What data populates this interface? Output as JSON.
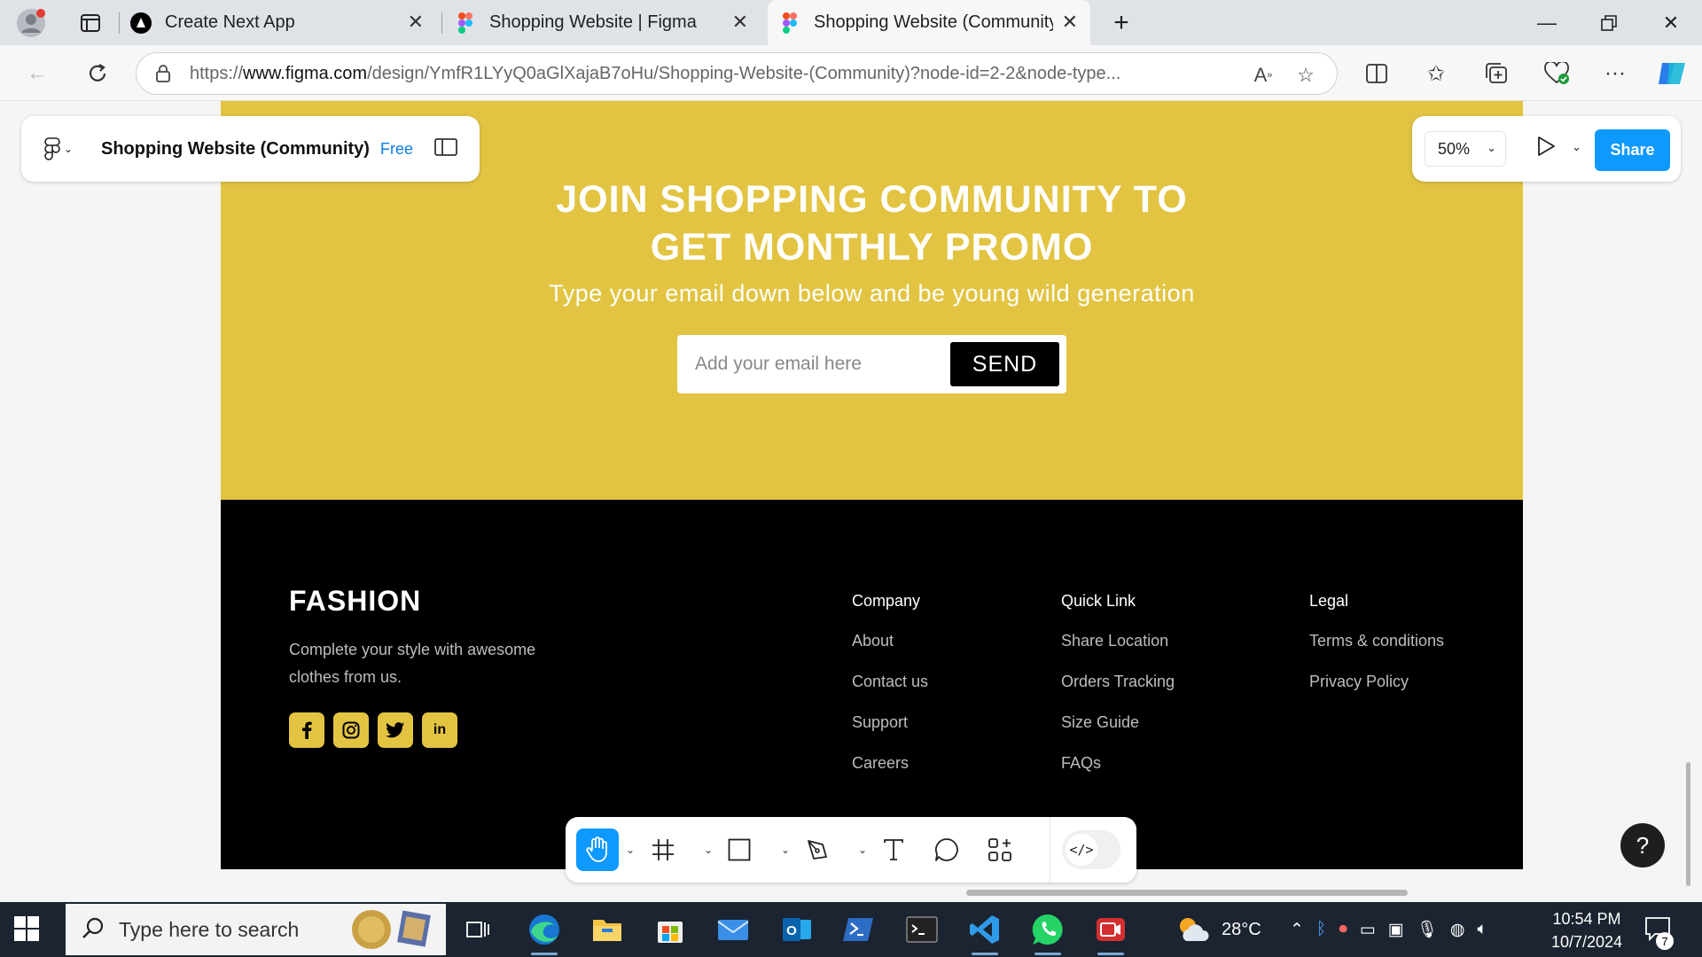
{
  "browser": {
    "tabs": [
      {
        "title": "Create Next App"
      },
      {
        "title": "Shopping Website | Figma"
      },
      {
        "title": "Shopping Website (Community) –"
      }
    ],
    "url": {
      "prefix": "https://",
      "host": "www.figma.com",
      "path": "/design/YmfR1LYyQ0aGlXajaB7oHu/Shopping-Website-(Community)?node-id=2-2&node-type..."
    }
  },
  "figma": {
    "file_title": "Shopping Website (Community)",
    "plan_badge": "Free",
    "zoom": "50%",
    "share_label": "Share",
    "help_label": "?"
  },
  "design": {
    "promo": {
      "title_line1": "JOIN SHOPPING COMMUNITY TO",
      "title_line2": "GET MONTHLY PROMO",
      "subtitle": "Type your email down below and be young wild generation",
      "email_placeholder": "Add your email here",
      "send_label": "SEND",
      "bg_color": "#e2c442"
    },
    "footer": {
      "brand": "FASHION",
      "tagline": "Complete your style with awesome clothes from us.",
      "socials": [
        "f",
        "ig",
        "tw",
        "in"
      ],
      "columns": [
        {
          "heading": "Company",
          "links": [
            "About",
            "Contact us",
            "Support",
            "Careers"
          ]
        },
        {
          "heading": "Quick Link",
          "links": [
            "Share Location",
            "Orders Tracking",
            "Size Guide",
            "FAQs"
          ]
        },
        {
          "heading": "Legal",
          "links": [
            "Terms & conditions",
            "Privacy Policy"
          ]
        }
      ]
    }
  },
  "taskbar": {
    "search_placeholder": "Type here to search",
    "weather": "28°C",
    "time": "10:54 PM",
    "date": "10/7/2024",
    "notification_count": "7"
  }
}
